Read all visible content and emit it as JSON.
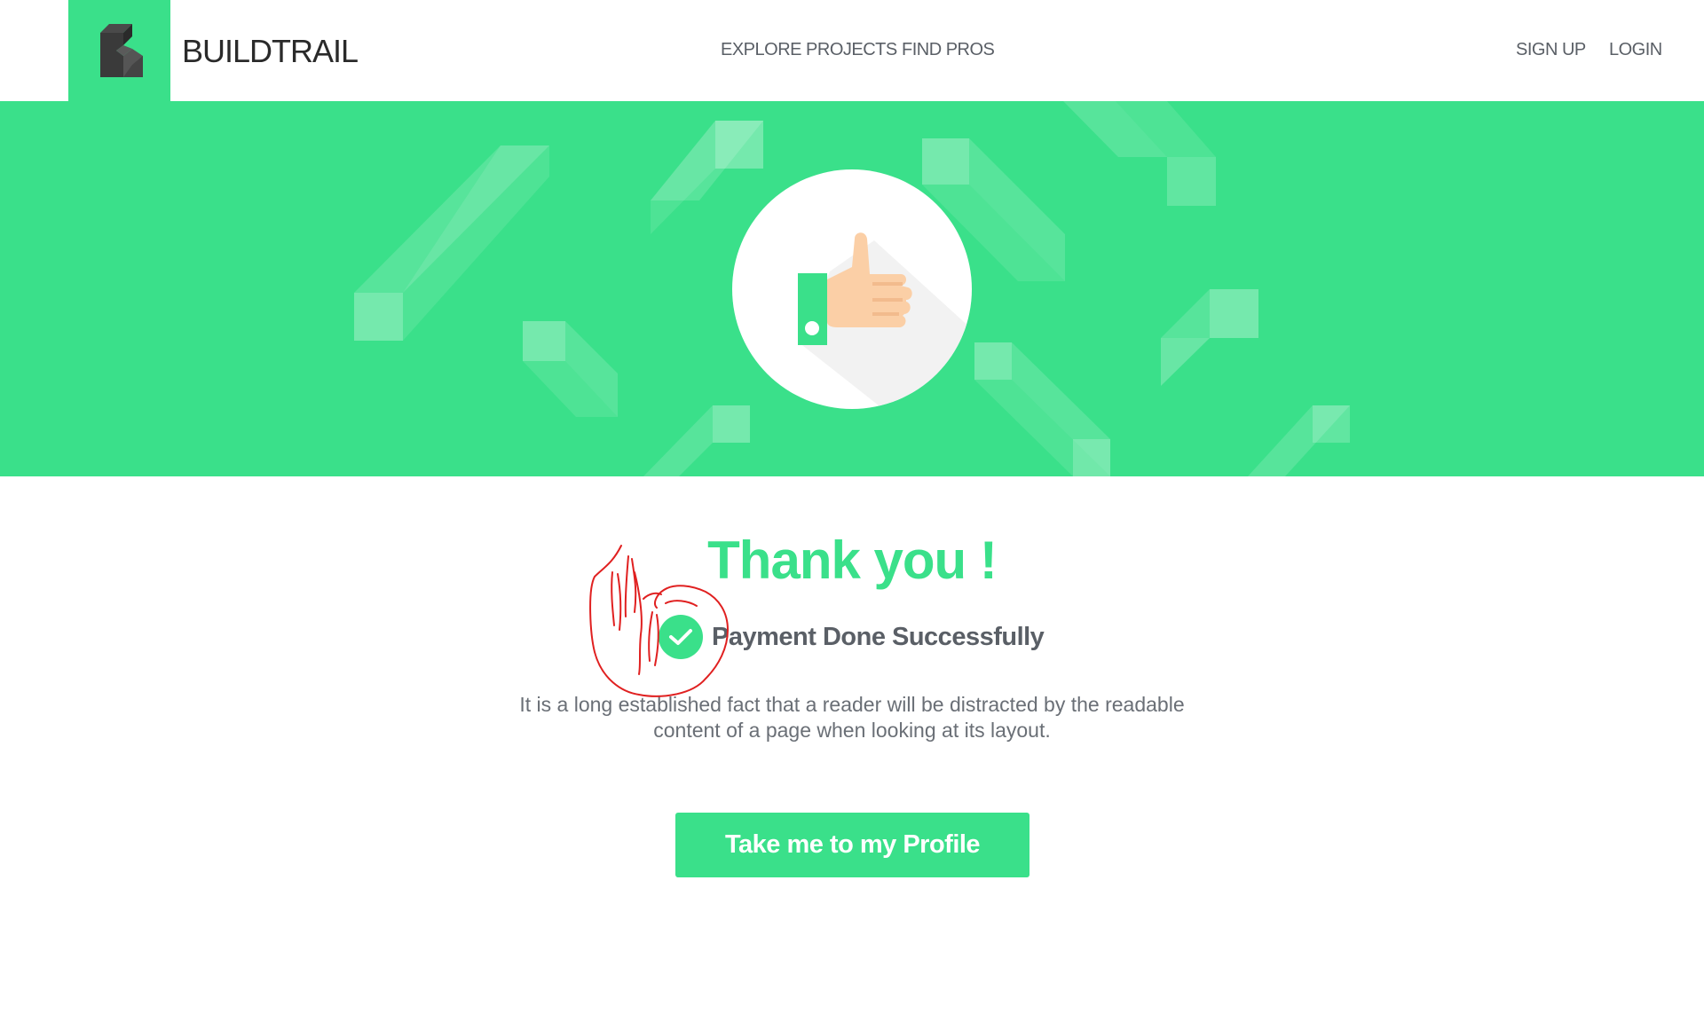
{
  "header": {
    "brand": "BUILDTRAIL",
    "nav": {
      "explore": "EXPLORE PROJECTS",
      "find_pros": "FIND PROS"
    },
    "auth": {
      "signup": "SIGN UP",
      "login": "LOGIN"
    },
    "logo_icon": "buildtrail-cube-icon"
  },
  "hero": {
    "icon": "thumbs-up-icon"
  },
  "content": {
    "title": "Thank you !",
    "status_icon": "check-circle-icon",
    "status": "Payment Done Successfully",
    "description": "It is a long established fact that a reader will be distracted by the readable content of a page when looking at its layout.",
    "cta_label": "Take me to my Profile"
  },
  "colors": {
    "accent": "#3ae08a",
    "text": "#5a5f66",
    "annotation": "#e02020"
  }
}
